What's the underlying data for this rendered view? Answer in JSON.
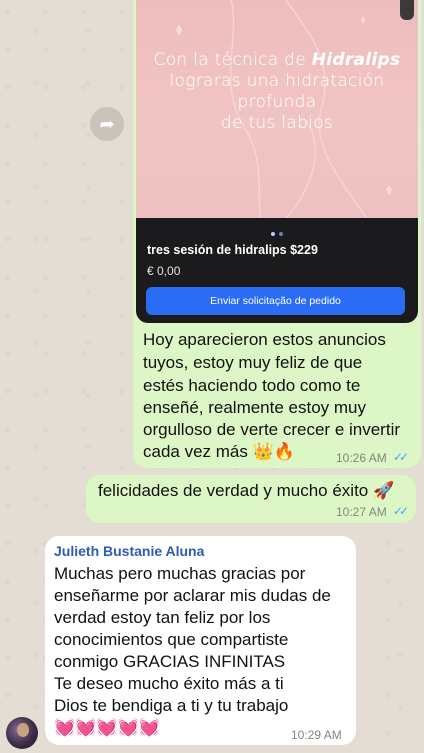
{
  "product_card": {
    "promo_line1_pre": "Con la técnica de ",
    "promo_brand": "Hidralips",
    "promo_line2": "lograras una hidratación profunda",
    "promo_line3": "de tus labios",
    "title": "tres sesión de hidralips $229",
    "price": "€ 0,00",
    "button_label": "Enviar solicitação de pedido"
  },
  "messages": [
    {
      "direction": "outgoing",
      "lines": [
        "Hoy aparecieron estos anuncios",
        "tuyos, estoy muy feliz de que",
        "estés haciendo todo como te",
        "enseñé, realmente estoy muy",
        "orgulloso de verte crecer e invertir",
        "cada vez más 👑🔥"
      ],
      "time": "10:26 AM",
      "status": "✓✓"
    },
    {
      "direction": "outgoing",
      "lines": [
        "felicidades de verdad y mucho éxito 🚀"
      ],
      "time": "10:27 AM",
      "status": "✓✓"
    },
    {
      "direction": "incoming",
      "sender": "Julieth Bustanie Aluna",
      "lines": [
        "Muchas pero muchas gracias por",
        "enseñarme por aclarar mis dudas de",
        "verdad estoy tan feliz por los",
        "conocimientos que compartiste",
        "conmigo GRACIAS INFINITAS",
        "Te deseo mucho éxito más a ti",
        "Dios te bendiga a ti y tu trabajo",
        "💓💓💓💓💓"
      ],
      "time": "10:29 AM"
    }
  ],
  "icons": {
    "forward": "forward-arrow-icon",
    "read_receipt": "double-check-icon"
  },
  "colors": {
    "outgoing_bubble": "#dcf7c5",
    "incoming_bubble": "#ffffff",
    "sender_name": "#2f5bb0",
    "read_ticks": "#4fa3f7",
    "order_button": "#2a6df4"
  }
}
